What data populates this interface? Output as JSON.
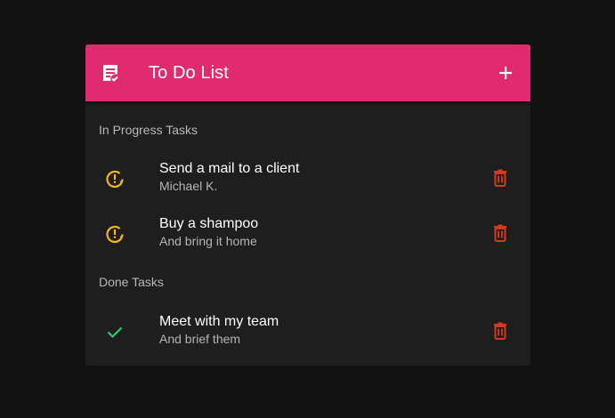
{
  "colors": {
    "background": "#121212",
    "card": "#1e1e1e",
    "header": "#e02b6f",
    "pending_icon": "#f5b51b",
    "done_icon": "#2ecc71",
    "delete_icon": "#d63a1e"
  },
  "header": {
    "title": "To Do List",
    "left_icon": "assignment-icon",
    "right_icon": "add-icon"
  },
  "sections": [
    {
      "label": "In Progress Tasks",
      "items": [
        {
          "title": "Send a mail to a client",
          "subtitle": "Michael K.",
          "status_icon": "pending-alert-icon",
          "action_icon": "delete-icon"
        },
        {
          "title": "Buy a shampoo",
          "subtitle": "And bring it home",
          "status_icon": "pending-alert-icon",
          "action_icon": "delete-icon"
        }
      ]
    },
    {
      "label": "Done Tasks",
      "items": [
        {
          "title": "Meet with my team",
          "subtitle": "And brief them",
          "status_icon": "check-icon",
          "action_icon": "delete-icon"
        }
      ]
    }
  ]
}
